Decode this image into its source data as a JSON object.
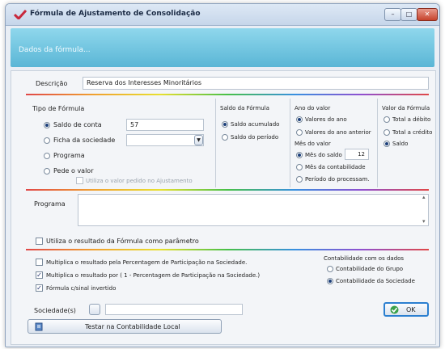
{
  "window": {
    "title": "Fórmula de Ajustamento de Consolidação",
    "buttons": {
      "minimize": "–",
      "maximize": "□",
      "close": "✕"
    }
  },
  "header": {
    "subtitle": "Dados da fórmula..."
  },
  "descricao": {
    "label": "Descrição",
    "value": "Reserva dos Interesses Minoritários"
  },
  "tipo_formula": {
    "title": "Tipo de Fórmula",
    "options": [
      "Saldo de conta",
      "Ficha da sociedade",
      "Programa",
      "Pede o valor"
    ],
    "selected": "Saldo de conta",
    "saldo_value": "57",
    "ficha_value": "",
    "utiliza_pedido_label": "Utiliza o valor pedido no Ajustamento"
  },
  "saldo_formula": {
    "title": "Saldo da Fórmula",
    "options": [
      "Saldo acumulado",
      "Saldo do período"
    ],
    "selected": "Saldo acumulado"
  },
  "ano_valor": {
    "title": "Ano do valor",
    "options": [
      "Valores do ano",
      "Valores do ano anterior"
    ],
    "selected": "Valores do ano"
  },
  "mes_valor": {
    "title": "Mês do valor",
    "options": [
      "Mês do saldo",
      "Mês da contabilidade",
      "Período do processam."
    ],
    "selected": "Mês do saldo",
    "mes_value": "12"
  },
  "valor_formula": {
    "title": "Valor da Fórmula",
    "options": [
      "Total a débito",
      "Total a crédito",
      "Saldo"
    ],
    "selected": "Saldo"
  },
  "programa": {
    "label": "Programa",
    "value": ""
  },
  "checks": {
    "utiliza_resultado": {
      "label": "Utiliza o resultado da Fórmula como parâmetro",
      "checked": false
    },
    "multiplica_percentagem": {
      "label": "Multiplica o resultado pela Percentagem de Participação na Sociedade.",
      "checked": false
    },
    "multiplica_por": {
      "label": "Multiplica o resultado por ( 1 - Percentagem de Participação na Sociedade.)",
      "checked": true
    },
    "sinal_invertido": {
      "label": "Fórmula c/sinal invertido",
      "checked": true
    }
  },
  "contabilidade_dados": {
    "title": "Contabilidade com os dados",
    "options": [
      "Contabilidade do Grupo",
      "Contabilidade da Sociedade"
    ],
    "selected": "Contabilidade da Sociedade"
  },
  "sociedades": {
    "label": "Sociedade(s)",
    "value": ""
  },
  "buttons": {
    "testar": "Testar na Contabilidade Local",
    "ok": "OK"
  },
  "colors": {
    "header": "#5ab6d6",
    "accent": "#1c3f7a"
  }
}
